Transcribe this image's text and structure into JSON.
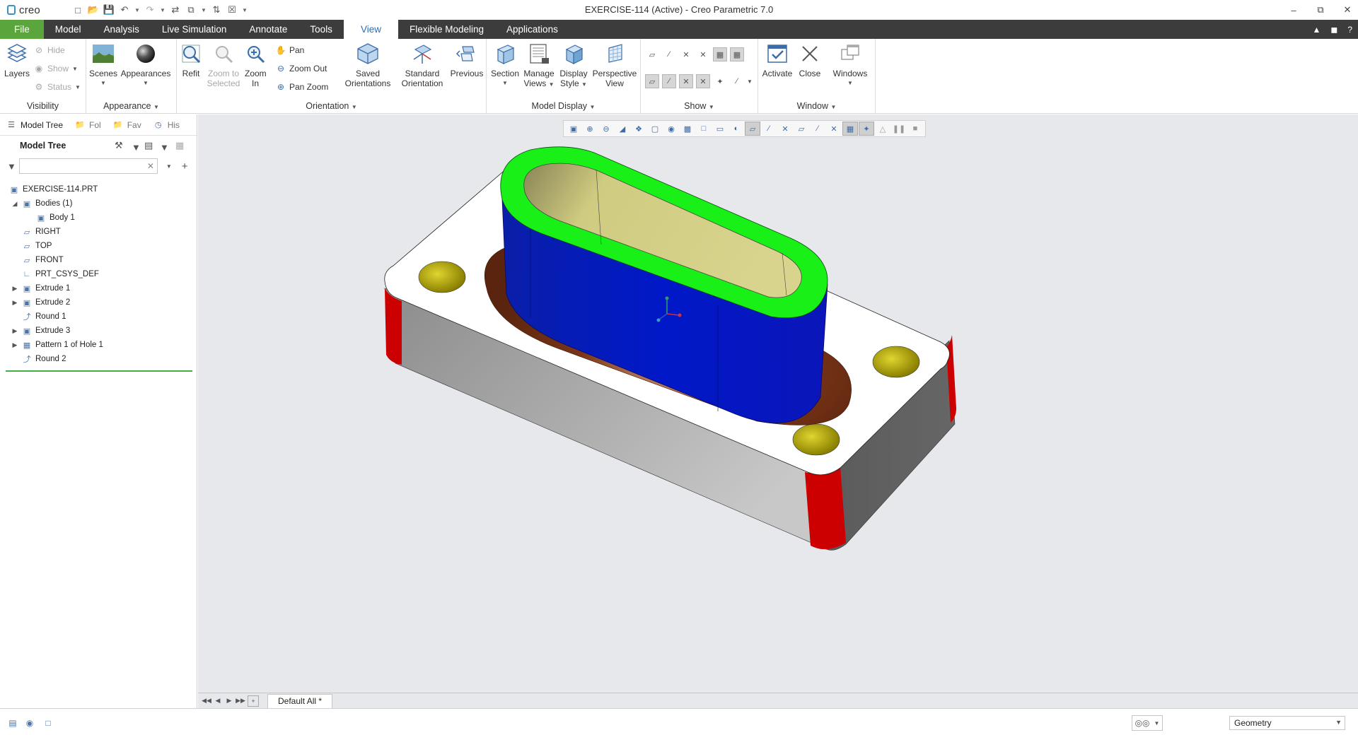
{
  "app": {
    "logo_text": "creo",
    "window_title": "EXERCISE-114 (Active) - Creo Parametric 7.0"
  },
  "quick_access": {
    "icons": [
      "new-icon",
      "open-icon",
      "save-icon",
      "undo-icon",
      "redo-icon",
      "regenerate-icon",
      "windows-icon",
      "close-window-icon"
    ]
  },
  "ribbon_tabs": [
    "File",
    "Model",
    "Analysis",
    "Live Simulation",
    "Annotate",
    "Tools",
    "View",
    "Flexible Modeling",
    "Applications"
  ],
  "active_tab": "View",
  "ribbon": {
    "visibility": {
      "label": "Visibility",
      "layers": "Layers",
      "hide": "Hide",
      "show": "Show",
      "status": "Status"
    },
    "appearance": {
      "label": "Appearance",
      "scenes": "Scenes",
      "appearances": "Appearances"
    },
    "orientation": {
      "label": "Orientation",
      "refit": "Refit",
      "zoom_to_selected": "Zoom to Selected",
      "zoom_in": "Zoom In",
      "pan": "Pan",
      "zoom_out": "Zoom Out",
      "pan_zoom": "Pan Zoom",
      "saved_orientations": "Saved Orientations",
      "standard_orientation": "Standard Orientation",
      "previous": "Previous"
    },
    "model_display": {
      "label": "Model Display",
      "section": "Section",
      "manage_views": "Manage Views",
      "display_style": "Display Style",
      "perspective_view": "Perspective View"
    },
    "show": {
      "label": "Show"
    },
    "window": {
      "label": "Window",
      "activate": "Activate",
      "close": "Close",
      "windows": "Windows"
    }
  },
  "panel_tabs": {
    "model_tree": "Model Tree",
    "folder": "Fol",
    "favorites": "Fav",
    "history": "His"
  },
  "model_tree": {
    "title": "Model Tree",
    "search_placeholder": "",
    "items": [
      {
        "label": "EXERCISE-114.PRT",
        "icon": "part-icon",
        "expander": ""
      },
      {
        "label": "Bodies (1)",
        "icon": "bodies-icon",
        "expander": "expanded"
      },
      {
        "label": "Body 1",
        "icon": "body-icon",
        "expander": ""
      },
      {
        "label": "RIGHT",
        "icon": "datum-plane-icon",
        "expander": ""
      },
      {
        "label": "TOP",
        "icon": "datum-plane-icon",
        "expander": ""
      },
      {
        "label": "FRONT",
        "icon": "datum-plane-icon",
        "expander": ""
      },
      {
        "label": "PRT_CSYS_DEF",
        "icon": "csys-icon",
        "expander": ""
      },
      {
        "label": "Extrude 1",
        "icon": "extrude-icon",
        "expander": "collapsed"
      },
      {
        "label": "Extrude 2",
        "icon": "extrude-icon",
        "expander": "collapsed"
      },
      {
        "label": "Round 1",
        "icon": "round-icon",
        "expander": ""
      },
      {
        "label": "Extrude 3",
        "icon": "extrude-icon",
        "expander": "collapsed"
      },
      {
        "label": "Pattern 1 of Hole 1",
        "icon": "pattern-icon",
        "expander": "collapsed"
      },
      {
        "label": "Round 2",
        "icon": "round-icon",
        "expander": ""
      }
    ]
  },
  "graphics": {
    "layer_tab": "Default All *",
    "colors": {
      "background": "#e6e8ec",
      "base_top": "#ffffff",
      "base_side_front": "#8c8c8c",
      "base_side_right": "#5a5a5a",
      "corner_rounds": "#cc0000",
      "boss_wall": "#0018c8",
      "boss_top": "#18f018",
      "pocket_inner": "#cfcb80",
      "fillet_round": "#7a3518",
      "holes": "#c8bd12"
    }
  },
  "status_bar": {
    "filter_value": "Geometry"
  }
}
